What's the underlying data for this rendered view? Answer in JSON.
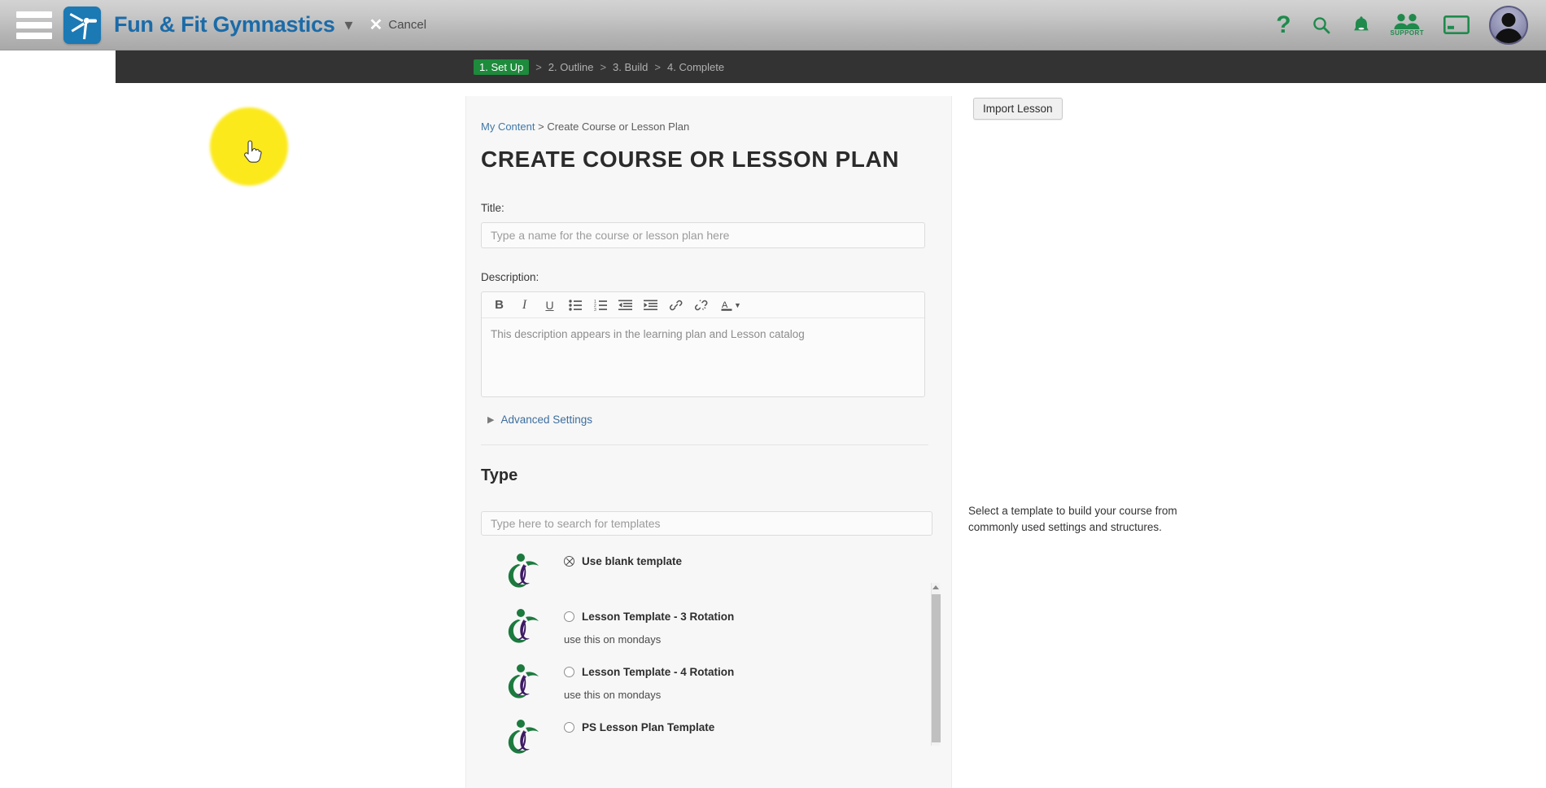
{
  "header": {
    "menu_icon": "hamburger-menu-icon",
    "logo_icon": "gymnast-logo-icon",
    "brand": "Fun & Fit Gymnastics",
    "brand_caret_icon": "chevron-down-icon",
    "cancel_icon": "close-x-icon",
    "cancel_label": "Cancel",
    "brand_color": "#1b6ba8",
    "icon_color": "#1f8a4c",
    "right_icons": [
      {
        "name": "help-icon",
        "glyph": "?"
      },
      {
        "name": "search-icon",
        "glyph": "search"
      },
      {
        "name": "notification-bell-icon",
        "glyph": "bell"
      },
      {
        "name": "support-icon",
        "glyph": "people",
        "label": "SUPPORT"
      },
      {
        "name": "billing-card-icon",
        "glyph": "credit-card"
      },
      {
        "name": "user-avatar",
        "glyph": "avatar"
      }
    ]
  },
  "wizard": {
    "active_color": "#1e8a3c",
    "steps": [
      {
        "label": "1. Set Up",
        "active": true
      },
      {
        "label": "2. Outline",
        "active": false
      },
      {
        "label": "3. Build",
        "active": false
      },
      {
        "label": "4. Complete",
        "active": false
      }
    ],
    "separator": ">"
  },
  "breadcrumb": {
    "root": "My Content",
    "separator": " > ",
    "current": "Create Course or Lesson Plan"
  },
  "page": {
    "title": "Create Course or Lesson Plan"
  },
  "form": {
    "title_label": "Title:",
    "title_value": "",
    "title_placeholder": "Type a name for the course or lesson plan here",
    "description_label": "Description:",
    "description_value": "",
    "description_placeholder": "This description appears in the learning plan and Lesson catalog",
    "advanced_settings_label": "Advanced Settings",
    "advanced_settings_arrow": "▶",
    "toolbar": [
      {
        "name": "bold-icon",
        "glyph": "B"
      },
      {
        "name": "italic-icon",
        "glyph": "I"
      },
      {
        "name": "underline-icon",
        "glyph": "U"
      },
      {
        "name": "bullet-list-icon",
        "glyph": "bullets"
      },
      {
        "name": "numbered-list-icon",
        "glyph": "numbers"
      },
      {
        "name": "outdent-icon",
        "glyph": "outdent"
      },
      {
        "name": "indent-icon",
        "glyph": "indent"
      },
      {
        "name": "link-icon",
        "glyph": "link"
      },
      {
        "name": "unlink-icon",
        "glyph": "unlink"
      },
      {
        "name": "text-color-icon",
        "glyph": "A"
      }
    ]
  },
  "type_section": {
    "heading": "Type",
    "search_value": "",
    "search_placeholder": "Type here to search for templates",
    "templates": [
      {
        "name": "Use blank template",
        "description": "",
        "selected": true
      },
      {
        "name": "Lesson Template - 3 Rotation",
        "description": "use this on mondays",
        "selected": false
      },
      {
        "name": "Lesson Template - 4 Rotation",
        "description": "use this on mondays",
        "selected": false
      },
      {
        "name": "PS Lesson Plan Template",
        "description": "",
        "selected": false
      }
    ]
  },
  "right_panel": {
    "import_button": "Import Lesson",
    "template_help": "Select a template to build your course from commonly used settings and structures."
  },
  "cursor": {
    "highlight_color": "#fbe91c",
    "icon": "pointing-hand-cursor"
  }
}
